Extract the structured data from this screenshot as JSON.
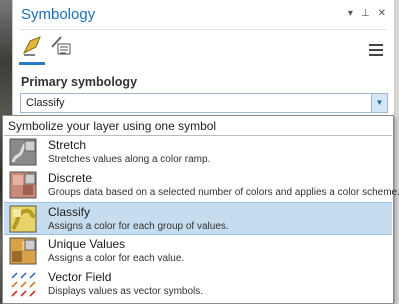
{
  "pane": {
    "title": "Symbology",
    "controls": [
      "▾",
      "⊥",
      "✕"
    ]
  },
  "section": {
    "label": "Primary symbology"
  },
  "dropdown": {
    "value": "Classify"
  },
  "popup": {
    "header": "Symbolize your layer using one symbol",
    "options": [
      {
        "title": "Stretch",
        "description": "Stretches values along a color ramp.",
        "icon": "stretch-icon",
        "selected": false
      },
      {
        "title": "Discrete",
        "description": "Groups data based on a selected number of colors and applies a color scheme.",
        "icon": "discrete-icon",
        "selected": false
      },
      {
        "title": "Classify",
        "description": "Assigns a color for each group of values.",
        "icon": "classify-icon",
        "selected": true
      },
      {
        "title": "Unique Values",
        "description": "Assigns a color for each value.",
        "icon": "unique-values-icon",
        "selected": false
      },
      {
        "title": "Vector Field",
        "description": "Displays values as vector symbols.",
        "icon": "vector-field-icon",
        "selected": false
      }
    ]
  },
  "colors": {
    "accent": "#1b6eb5",
    "selected_bg": "#c6ddef"
  }
}
